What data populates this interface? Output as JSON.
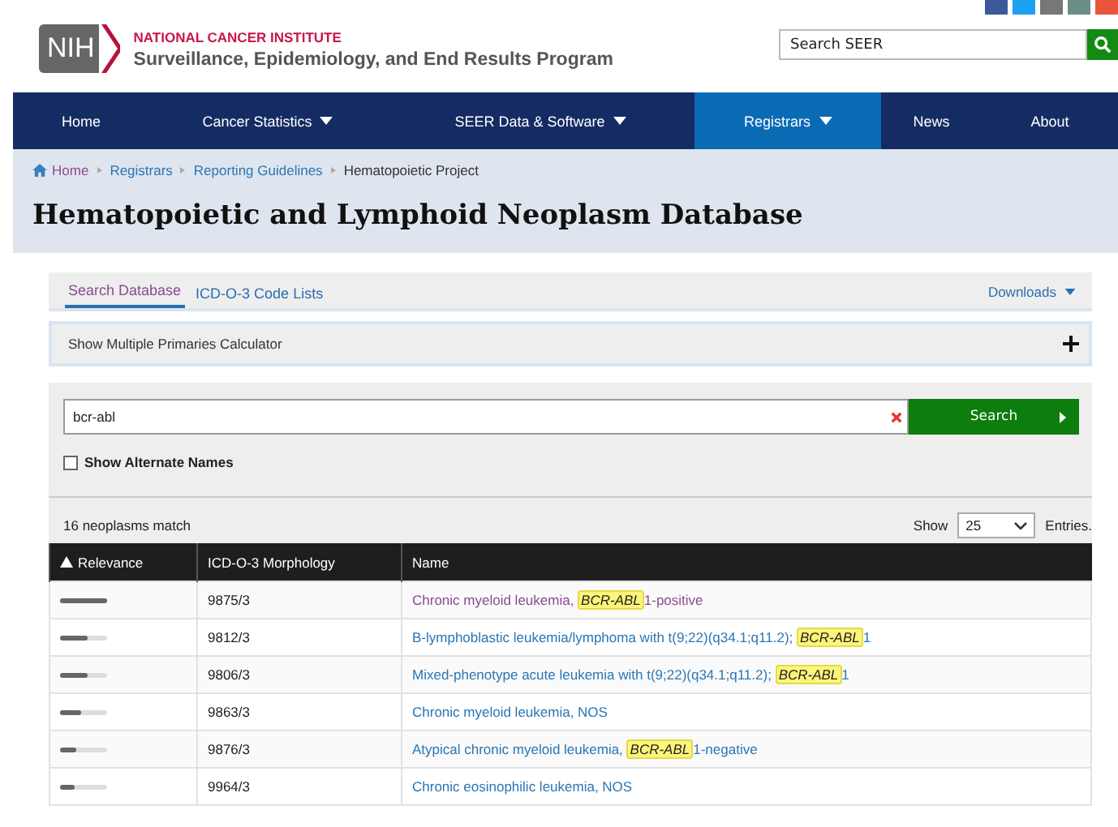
{
  "header": {
    "org": "NATIONAL CANCER INSTITUTE",
    "program": "Surveillance, Epidemiology, and End Results Program",
    "logo": "NIH",
    "search": {
      "placeholder": "Search SEER"
    }
  },
  "nav": [
    {
      "label": "Home",
      "dropdown": false,
      "selected": false
    },
    {
      "label": "Cancer Statistics",
      "dropdown": true,
      "selected": false
    },
    {
      "label": "SEER Data & Software",
      "dropdown": true,
      "selected": false
    },
    {
      "label": "Registrars",
      "dropdown": true,
      "selected": true
    },
    {
      "label": "News",
      "dropdown": false,
      "selected": false
    },
    {
      "label": "About",
      "dropdown": false,
      "selected": false
    }
  ],
  "breadcrumb": [
    "Home",
    "Registrars",
    "Reporting Guidelines",
    "Hematopoietic Project"
  ],
  "title": "Hematopoietic and Lymphoid Neoplasm Database",
  "tabs": [
    {
      "label": "Search Database",
      "selected": true
    },
    {
      "label": "ICD-O-3 Code Lists",
      "selected": false
    }
  ],
  "downloads": "Downloads",
  "calculator": {
    "label": "Show Multiple Primaries Calculator",
    "expanded": false
  },
  "search": {
    "value": "bcr-abl",
    "button": "Search"
  },
  "alternate_names": {
    "label": "Show Alternate Names",
    "checked": false
  },
  "match_count": "16 neoplasms match",
  "page_size": {
    "before": "Show",
    "value": "25",
    "after": "Entries."
  },
  "table": {
    "columns": [
      "Relevance",
      "ICD-O-3 Morphology",
      "Name"
    ],
    "rows": [
      {
        "level": 1.0,
        "code": "9875/3",
        "name": [
          {
            "text": "Chronic myeloid leukemia, ",
            "highlighted": false
          },
          {
            "text": "BCR-ABL",
            "highlighted": true
          },
          {
            "text": "1-positive",
            "highlighted": false
          }
        ],
        "visited": true
      },
      {
        "level": 0.6,
        "code": "9812/3",
        "name": [
          {
            "text": "B-lymphoblastic leukemia/lymphoma with t(9;22)(q34.1;q11.2); ",
            "highlighted": false
          },
          {
            "text": "BCR-ABL",
            "highlighted": true
          },
          {
            "text": "1",
            "highlighted": false
          }
        ],
        "visited": false
      },
      {
        "level": 0.6,
        "code": "9806/3",
        "name": [
          {
            "text": "Mixed-phenotype acute leukemia with t(9;22)(q34.1;q11.2); ",
            "highlighted": false
          },
          {
            "text": "BCR-ABL",
            "highlighted": true
          },
          {
            "text": "1",
            "highlighted": false
          }
        ],
        "visited": false
      },
      {
        "level": 0.45,
        "code": "9863/3",
        "name": [
          {
            "text": "Chronic myeloid leukemia, NOS",
            "highlighted": false
          }
        ],
        "visited": false
      },
      {
        "level": 0.35,
        "code": "9876/3",
        "name": [
          {
            "text": "Atypical chronic myeloid leukemia, ",
            "highlighted": false
          },
          {
            "text": "BCR-ABL",
            "highlighted": true
          },
          {
            "text": "1-negative",
            "highlighted": false
          }
        ],
        "visited": false
      },
      {
        "level": 0.3,
        "code": "9964/3",
        "name": [
          {
            "text": "Chronic eosinophilic leukemia, NOS",
            "highlighted": false
          }
        ],
        "visited": false
      }
    ]
  }
}
